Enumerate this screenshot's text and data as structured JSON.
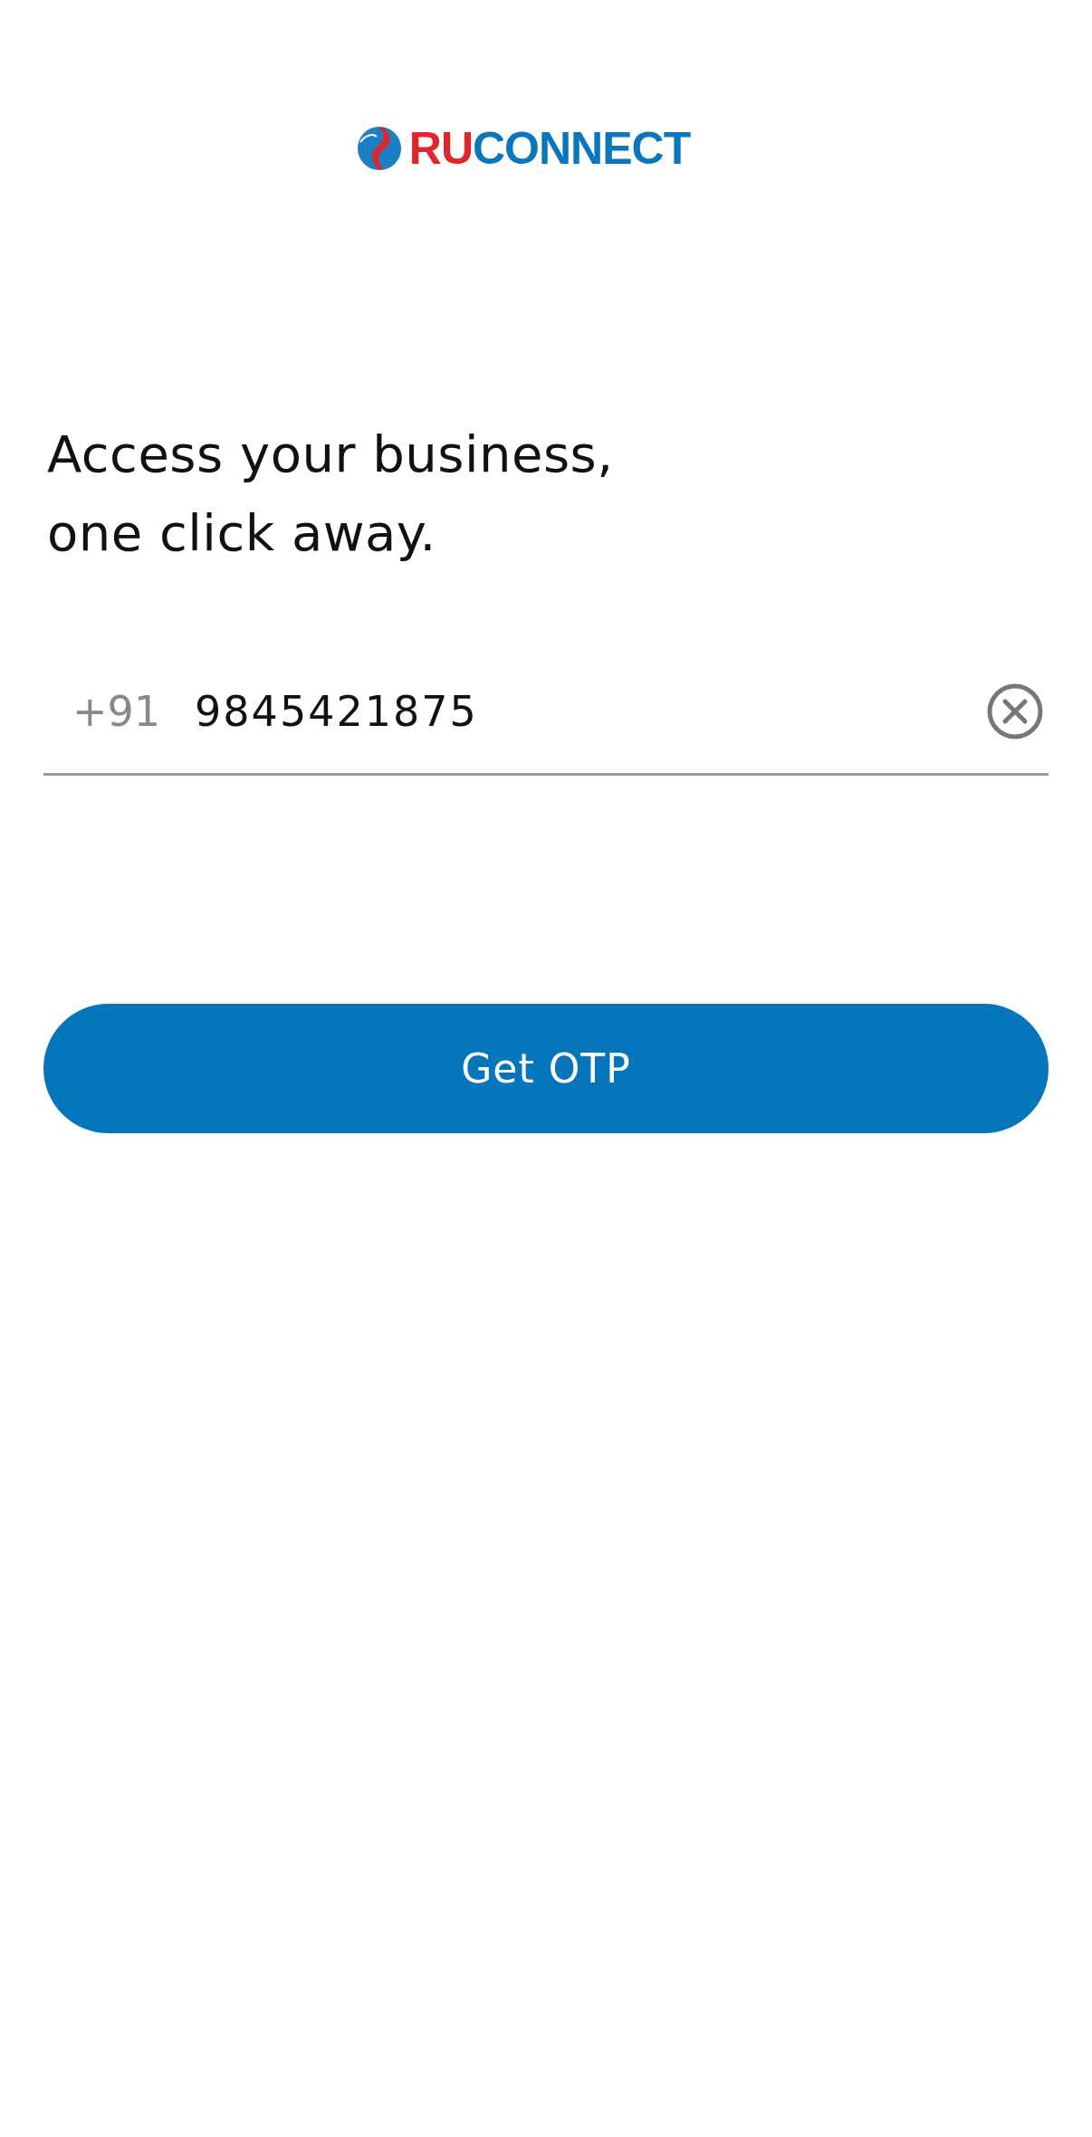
{
  "logo": {
    "prefix": "RU",
    "suffix": "CONNECT"
  },
  "heading": [
    "Access your business,",
    "one click away."
  ],
  "phone_field": {
    "country_code": "+91",
    "value": "9845421875"
  },
  "buttons": [
    {
      "label": "Get OTP"
    }
  ]
}
